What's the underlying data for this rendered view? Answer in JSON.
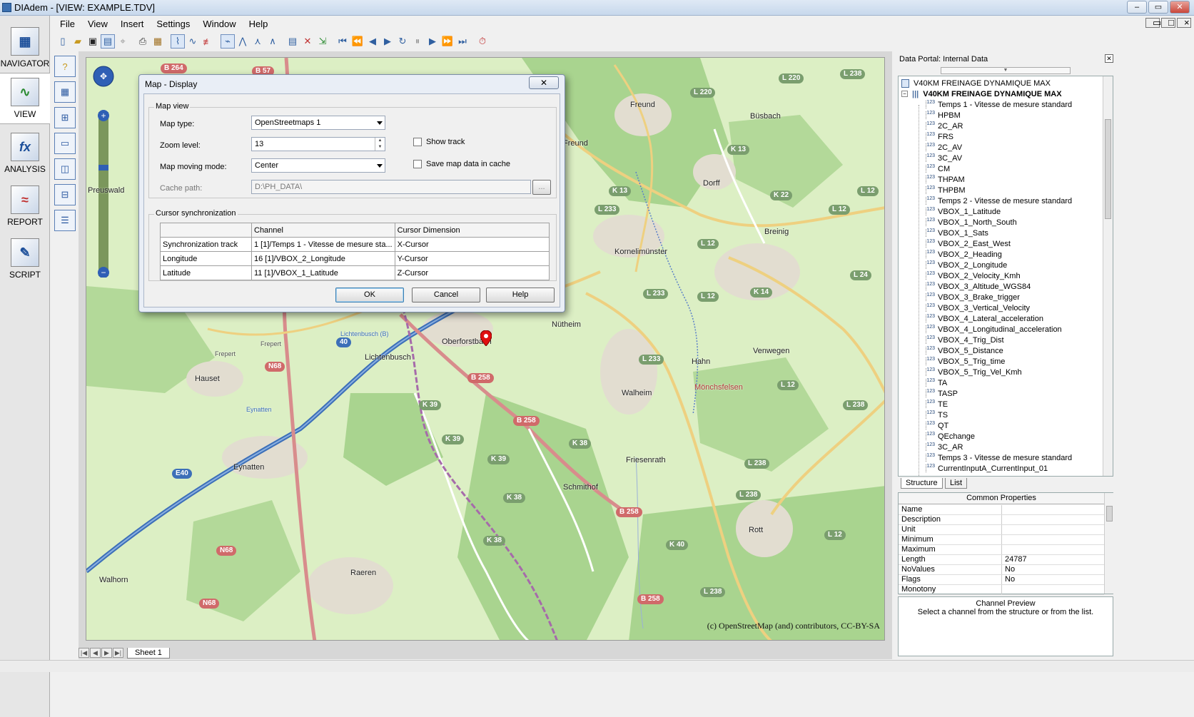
{
  "window": {
    "title": "DIAdem - [VIEW:  EXAMPLE.TDV]",
    "controls": [
      "–",
      "▭",
      "✕"
    ]
  },
  "menu": [
    "File",
    "View",
    "Insert",
    "Settings",
    "Window",
    "Help"
  ],
  "nav": [
    {
      "label": "NAVIGATOR",
      "icon": "navigator-icon"
    },
    {
      "label": "VIEW",
      "icon": "view-icon"
    },
    {
      "label": "ANALYSIS",
      "icon": "analysis-icon"
    },
    {
      "label": "REPORT",
      "icon": "report-icon"
    },
    {
      "label": "SCRIPT",
      "icon": "script-icon"
    }
  ],
  "map": {
    "copyright": "(c) OpenStreetMap (and) contributors, CC-BY-SA",
    "places": [
      "Freund",
      "Büsbach",
      "Dorff",
      "Breinig",
      "Kornelimünster",
      "Nütheim",
      "Oberforstbach",
      "Lichtenbusch",
      "Lichtenbusch (B)",
      "Hauset",
      "Eynatten",
      "Eynatten",
      "Walheim",
      "Hahn",
      "Venwegen",
      "Mönchsfelsen",
      "Friesenrath",
      "Schmithof",
      "Raeren",
      "Walhorn",
      "Rott",
      "Preuswald",
      "Freund",
      "Frepert",
      "Frepert"
    ],
    "roads": [
      "B 264",
      "B 57",
      "L 220",
      "L 238",
      "L 220",
      "K 13",
      "K 22",
      "L 12",
      "K 13",
      "L 233",
      "L 12",
      "L 12",
      "L 233",
      "L 12",
      "K 14",
      "L 24",
      "B 258",
      "L 233",
      "N68",
      "K 39",
      "K 39",
      "B 258",
      "K 38",
      "K 39",
      "L 12",
      "L 238",
      "K 38",
      "B 258",
      "L 238",
      "L 238",
      "K 40",
      "N68",
      "N68",
      "K 38",
      "E40",
      "L 12",
      "B 258",
      "L 238",
      "40"
    ]
  },
  "dialog": {
    "title": "Map - Display",
    "close": "✕",
    "map_view": "Map view",
    "map_type_label": "Map type:",
    "map_type": "OpenStreetmaps 1",
    "zoom_label": "Zoom level:",
    "zoom": "13",
    "moving_label": "Map moving mode:",
    "moving": "Center",
    "cache_label": "Cache path:",
    "cache": "D:\\PH_DATA\\",
    "cache_btn": "...",
    "show_track": "Show track",
    "save_cache": "Save map data in cache",
    "cursor_sync": "Cursor synchronization",
    "table_headers": [
      "",
      "Channel",
      "Cursor Dimension"
    ],
    "table_rows": [
      [
        "Synchronization track",
        "1  [1]/Temps  1 - Vitesse de mesure sta...",
        "X-Cursor"
      ],
      [
        "Longitude",
        "16  [1]/VBOX_2_Longitude",
        "Y-Cursor"
      ],
      [
        "Latitude",
        "11  [1]/VBOX_1_Latitude",
        "Z-Cursor"
      ]
    ],
    "ok": "OK",
    "cancel": "Cancel",
    "help": "Help"
  },
  "sheet": {
    "tab": "Sheet 1"
  },
  "portal": {
    "title": "Data Portal: Internal Data",
    "close": "✕",
    "root": "V40KM FREINAGE DYNAMIQUE MAX",
    "group": "V40KM FREINAGE DYNAMIQUE MAX",
    "channels": [
      "Temps  1 - Vitesse de mesure standard",
      "HPBM",
      "2C_AR",
      "FRS",
      "2C_AV",
      "3C_AV",
      "CM",
      "THPAM",
      "THPBM",
      "Temps  2 - Vitesse de mesure standard",
      "VBOX_1_Latitude",
      "VBOX_1_North_South",
      "VBOX_1_Sats",
      "VBOX_2_East_West",
      "VBOX_2_Heading",
      "VBOX_2_Longitude",
      "VBOX_2_Velocity_Kmh",
      "VBOX_3_Altitude_WGS84",
      "VBOX_3_Brake_trigger",
      "VBOX_3_Vertical_Velocity",
      "VBOX_4_Lateral_acceleration",
      "VBOX_4_Longitudinal_acceleration",
      "VBOX_4_Trig_Dist",
      "VBOX_5_Distance",
      "VBOX_5_Trig_time",
      "VBOX_5_Trig_Vel_Kmh",
      "TA",
      "TASP",
      "TE",
      "TS",
      "QT",
      "QEchange",
      "3C_AR",
      "Temps  3 - Vitesse de mesure standard",
      "CurrentInputA_CurrentInput_01"
    ],
    "tabs": [
      "Structure",
      "List"
    ],
    "props_title": "Common Properties",
    "props": [
      [
        "Name",
        ""
      ],
      [
        "Description",
        ""
      ],
      [
        "Unit",
        ""
      ],
      [
        "Minimum",
        ""
      ],
      [
        "Maximum",
        ""
      ],
      [
        "Length",
        "24787"
      ],
      [
        "NoValues",
        "No"
      ],
      [
        "Flags",
        "No"
      ],
      [
        "Monotony",
        ""
      ]
    ],
    "preview_title": "Channel Preview",
    "preview_text": "Select a channel from the structure or from the list."
  }
}
